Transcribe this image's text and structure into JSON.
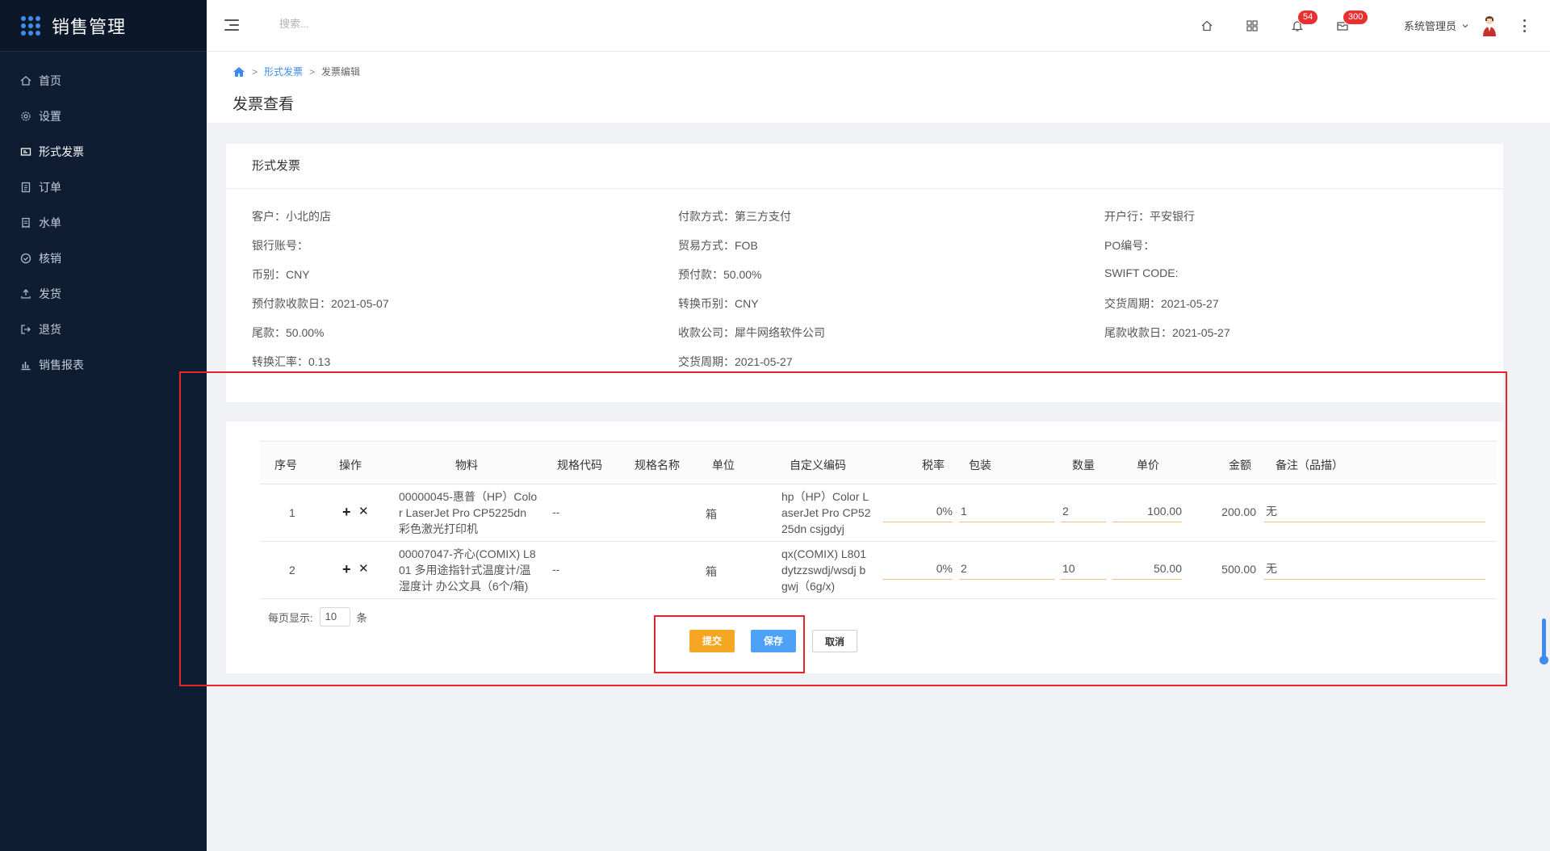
{
  "app": {
    "title": "销售管理"
  },
  "sidebar": {
    "items": [
      {
        "label": "首页",
        "icon": "home-icon"
      },
      {
        "label": "设置",
        "icon": "gear-icon"
      },
      {
        "label": "形式发票",
        "icon": "invoice-icon"
      },
      {
        "label": "订单",
        "icon": "order-icon"
      },
      {
        "label": "水单",
        "icon": "receipt-icon"
      },
      {
        "label": "核销",
        "icon": "check-circle-icon"
      },
      {
        "label": "发货",
        "icon": "upload-icon"
      },
      {
        "label": "退货",
        "icon": "return-icon"
      },
      {
        "label": "销售报表",
        "icon": "bar-chart-icon"
      }
    ]
  },
  "topbar": {
    "search_placeholder": "搜索...",
    "notifications_count": "54",
    "messages_count": "300",
    "user_name": "系统管理员"
  },
  "breadcrumb": {
    "home": "home-icon",
    "items": [
      "形式发票",
      "发票编辑"
    ]
  },
  "page": {
    "title": "发票查看"
  },
  "invoice": {
    "section_title": "形式发票",
    "fields": [
      {
        "label": "客户：",
        "value": "小北的店"
      },
      {
        "label": "付款方式：",
        "value": "第三方支付"
      },
      {
        "label": "开户行：",
        "value": "平安银行"
      },
      {
        "label": "银行账号：",
        "value": ""
      },
      {
        "label": "贸易方式：",
        "value": "FOB"
      },
      {
        "label": "PO编号：",
        "value": ""
      },
      {
        "label": "币别：",
        "value": "CNY"
      },
      {
        "label": "预付款：",
        "value": "50.00%"
      },
      {
        "label": "SWIFT CODE:",
        "value": ""
      },
      {
        "label": "预付款收款日：",
        "value": "2021-05-07"
      },
      {
        "label": "转换币别：",
        "value": "CNY"
      },
      {
        "label": "交货周期：",
        "value": "2021-05-27"
      },
      {
        "label": "尾款：",
        "value": "50.00%"
      },
      {
        "label": "收款公司：",
        "value": "犀牛网络软件公司"
      },
      {
        "label": "尾款收款日：",
        "value": "2021-05-27"
      },
      {
        "label": "转换汇率：",
        "value": "0.13"
      },
      {
        "label": "交货周期：",
        "value": "2021-05-27"
      }
    ]
  },
  "table": {
    "headers": [
      "序号",
      "操作",
      "物料",
      "规格代码",
      "规格名称",
      "单位",
      "自定义编码",
      "税率",
      "包装",
      "数量",
      "单价",
      "金额",
      "备注（品描）"
    ],
    "rows": [
      {
        "seq": "1",
        "material": [
          "00000045-惠普（HP）Colo",
          "r LaserJet Pro CP5225dn",
          "彩色激光打印机"
        ],
        "spec_code": "--",
        "spec_name": "",
        "unit": "箱",
        "custom_code": [
          "hp（HP）Color L",
          "aserJet Pro CP52",
          "25dn csjgdyj"
        ],
        "tax": "0%",
        "pack": "1",
        "qty": "2",
        "price": "100.00",
        "amount": "200.00",
        "remark": "无"
      },
      {
        "seq": "2",
        "material": [
          "00007047-齐心(COMIX) L8",
          "01 多用途指针式温度计/温",
          "湿度计 办公文具（6个/箱)"
        ],
        "spec_code": "--",
        "spec_name": "",
        "unit": "箱",
        "custom_code": [
          "qx(COMIX) L801",
          "dytzzswdj/wsdj b",
          "gwj（6g/x)"
        ],
        "tax": "0%",
        "pack": "2",
        "qty": "10",
        "price": "50.00",
        "amount": "500.00",
        "remark": "无"
      }
    ],
    "ops": {
      "add": "+",
      "delete": "✕"
    }
  },
  "pager": {
    "label": "每页显示:",
    "value": "10",
    "suffix": "条"
  },
  "buttons": {
    "submit": "提交",
    "save": "保存",
    "cancel": "取消"
  },
  "colors": {
    "sidebar_bg": "#0f1d33",
    "accent": "#3e8cef",
    "submit": "#f5a623",
    "save": "#4da1f6",
    "highlight": "#e5242b",
    "badge": "#e83030"
  }
}
